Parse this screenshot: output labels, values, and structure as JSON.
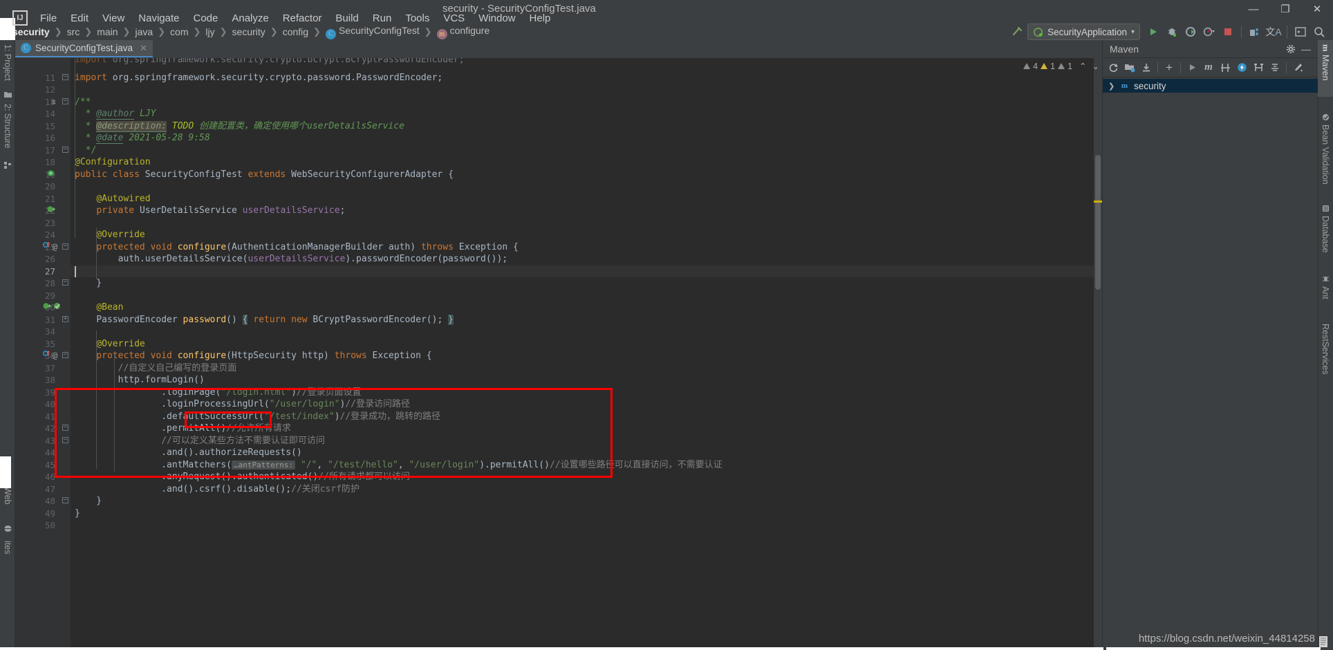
{
  "window": {
    "title": "security - SecurityConfigTest.java",
    "minimize": "—",
    "maximize": "❐",
    "close": "✕",
    "logo": "IJ"
  },
  "menu": {
    "items": [
      "File",
      "Edit",
      "View",
      "Navigate",
      "Code",
      "Analyze",
      "Refactor",
      "Build",
      "Run",
      "Tools",
      "VCS",
      "Window",
      "Help"
    ]
  },
  "breadcrumb": {
    "items": [
      {
        "label": "security",
        "icon": ""
      },
      {
        "label": "src",
        "icon": ""
      },
      {
        "label": "main",
        "icon": ""
      },
      {
        "label": "java",
        "icon": ""
      },
      {
        "label": "com",
        "icon": ""
      },
      {
        "label": "ljy",
        "icon": ""
      },
      {
        "label": "security",
        "icon": ""
      },
      {
        "label": "config",
        "icon": ""
      },
      {
        "label": "SecurityConfigTest",
        "icon": "C"
      },
      {
        "label": "configure",
        "icon": "m"
      }
    ],
    "separator": "❯"
  },
  "toolbar": {
    "build_icon": "build-hammer-icon",
    "run_config": "SecurityApplication",
    "run_config_caret": "▾",
    "run": "▶",
    "debug": "debug-bug-icon",
    "run_coverage": "coverage-icon",
    "profiler": "profiler-icon",
    "profiler_caret": "▾",
    "stop": "■",
    "project_structure": "project-structure-icon",
    "translate": "translate-icon",
    "terminal": "terminal-icon",
    "search": "⌕"
  },
  "left_strip": {
    "items": [
      {
        "label": "1: Project",
        "icon": "folder-icon"
      },
      {
        "label": "2: Structure",
        "icon": "structure-icon"
      },
      {
        "label": "Web",
        "icon": "globe-icon"
      },
      {
        "label": "ites",
        "icon": ""
      }
    ]
  },
  "right_strip": {
    "items": [
      {
        "label": "Maven",
        "icon": "m",
        "active": true
      },
      {
        "label": "Bean Validation",
        "icon": "bean-icon",
        "active": false
      },
      {
        "label": "Database",
        "icon": "database-icon",
        "active": false
      },
      {
        "label": "Ant",
        "icon": "ant-icon",
        "active": false
      },
      {
        "label": "RestServices",
        "icon": "",
        "active": false
      }
    ]
  },
  "editor_tab": {
    "label": "SecurityConfigTest.java",
    "icon": "C",
    "close": "✕"
  },
  "inspections": {
    "items": [
      {
        "icon": "grey-triangle-icon",
        "count": "4",
        "severity": "grey"
      },
      {
        "icon": "yellow-triangle-icon",
        "count": "1",
        "severity": "yellow"
      },
      {
        "icon": "grey-triangle-icon",
        "count": "1",
        "severity": "grey"
      }
    ],
    "prev": "⌃",
    "next": "⌄"
  },
  "maven": {
    "title": "Maven",
    "settings_icon": "gear-icon",
    "hide_icon": "—",
    "toolbar": [
      {
        "name": "reload-icon",
        "glyph": "⟳"
      },
      {
        "name": "add-maven-project-icon",
        "glyph": "Ὄ1"
      },
      {
        "name": "download-sources-icon",
        "glyph": "⤓"
      },
      {
        "name": "add-icon",
        "glyph": "＋"
      },
      {
        "name": "run-icon",
        "glyph": "▶"
      },
      {
        "name": "execute-maven-goal-icon",
        "glyph": "m"
      },
      {
        "name": "toggle-skip-tests-icon",
        "glyph": "⫴"
      },
      {
        "name": "toggle-offline-icon",
        "glyph": "⚡"
      },
      {
        "name": "show-dependencies-icon",
        "glyph": "⬌"
      },
      {
        "name": "collapse-all-icon",
        "glyph": "⫫"
      },
      {
        "name": "maven-settings-icon",
        "glyph": "⚒"
      }
    ],
    "tree": [
      {
        "label": "security",
        "chevron": "❯",
        "icon": "m",
        "selected": true
      }
    ]
  },
  "watermark": "https://blog.csdn.net/weixin_44814258",
  "code": {
    "lines": [
      {
        "n": "",
        "top_cut": true,
        "html": "<span class=\"kw\">import</span> org.springframework.security.crypto.bcrypt.BCryptPasswordEncoder;"
      },
      {
        "n": "11",
        "html": "<span class=\"kw\">import</span> org.springframework.security.crypto.password.PasswordEncoder;"
      },
      {
        "n": "12",
        "html": ""
      },
      {
        "n": "13",
        "html": "<span class=\"doc\">/**</span>"
      },
      {
        "n": "14",
        "html": "  <span class=\"doc\">*</span> <span class=\"docTag\">@author</span> <span class=\"doct\">LJY</span>"
      },
      {
        "n": "15",
        "html": "  <span class=\"doc\">*</span> <span class=\"dtagHl\">@description:</span> <span class=\"todo\">TODO</span> <span class=\"doct\">创建配置类，确定使用哪个userDetailsService</span>"
      },
      {
        "n": "16",
        "html": "  <span class=\"doc\">*</span> <span class=\"docTag\">@date</span> <span class=\"doct\">2021-05-28 9:58</span>"
      },
      {
        "n": "17",
        "html": "  <span class=\"doc\">*/</span>"
      },
      {
        "n": "18",
        "html": "<span class=\"anno\">@Configuration</span>"
      },
      {
        "n": "19",
        "html": "<span class=\"kw\">public class</span> <span class=\"cls\">SecurityConfigTest</span> <span class=\"kw\">extends</span> <span class=\"cls\">WebSecurityConfigurerAdapter</span> {"
      },
      {
        "n": "20",
        "html": ""
      },
      {
        "n": "21",
        "html": "    <span class=\"anno\">@Autowired</span>"
      },
      {
        "n": "22",
        "html": "    <span class=\"kw\">private</span> <span class=\"cls\">UserDetailsService</span> <span class=\"fld\">userDetailsService</span>;"
      },
      {
        "n": "23",
        "html": ""
      },
      {
        "n": "24",
        "html": "    <span class=\"anno\">@Override</span>"
      },
      {
        "n": "25",
        "html": "    <span class=\"kw\">protected void</span> <span class=\"mth\">configure</span>(<span class=\"cls\">AuthenticationManagerBuilder</span> auth) <span class=\"kw\">throws</span> <span class=\"cls\">Exception</span> {"
      },
      {
        "n": "26",
        "html": "        auth.userDetailsService(<span class=\"fld\">userDetailsService</span>).passwordEncoder(password());"
      },
      {
        "n": "27",
        "html": "",
        "current": true
      },
      {
        "n": "28",
        "html": "    }"
      },
      {
        "n": "29",
        "html": ""
      },
      {
        "n": "30",
        "html": "    <span class=\"anno\">@Bean</span>"
      },
      {
        "n": "31",
        "html": "    <span class=\"cls\">PasswordEncoder</span> <span class=\"mth\">password</span>() <span class=\"braceHl\">{</span> <span class=\"kw\">return new</span> <span class=\"cls\">BCryptPasswordEncoder</span>(); <span class=\"braceHl\">}</span>"
      },
      {
        "n": "34",
        "html": ""
      },
      {
        "n": "35",
        "html": "    <span class=\"anno\">@Override</span>"
      },
      {
        "n": "36",
        "html": "    <span class=\"kw\">protected void</span> <span class=\"mth\">configure</span>(<span class=\"cls\">HttpSecurity</span> http) <span class=\"kw\">throws</span> <span class=\"cls\">Exception</span> {"
      },
      {
        "n": "37",
        "html": "        <span class=\"cmt\">//自定义自己编写的登录页面</span>"
      },
      {
        "n": "38",
        "html": "        http.formLogin()"
      },
      {
        "n": "39",
        "html": "                .loginPage(<span class=\"str\">\"/login.html\"</span>)<span class=\"cmt\">//登录页面设置</span>"
      },
      {
        "n": "40",
        "html": "                .loginProcessingUrl(<span class=\"str\">\"/user/login\"</span>)<span class=\"cmt\">//登录访问路径</span>"
      },
      {
        "n": "41",
        "html": "                .defaultSuccessUrl(<span class=\"str\">\"/test/index\"</span>)<span class=\"cmt\">//登录成功，跳转的路径</span>"
      },
      {
        "n": "42",
        "html": "                .permitAll()<span class=\"cmt\">//允许所有请求</span>"
      },
      {
        "n": "43",
        "html": "                <span class=\"cmt\">//可以定义某些方法不需要认证即可访问</span>"
      },
      {
        "n": "44",
        "html": "                .and().authorizeRequests()"
      },
      {
        "n": "45",
        "html": "                .antMatchers(<span class=\"hint\">…antPatterns:</span> <span class=\"str\">\"/\"</span>, <span class=\"str\">\"/test/hello\"</span>, <span class=\"str\">\"/user/login\"</span>).permitAll()<span class=\"cmt\">//设置哪些路径可以直接访问，不需要认证</span>"
      },
      {
        "n": "46",
        "html": "                .anyRequest().authenticated()<span class=\"cmt\">//所有请求都可以访问</span>"
      },
      {
        "n": "47",
        "html": "                .and().csrf().disable();<span class=\"cmt\">//关闭csrf防护</span>"
      },
      {
        "n": "48",
        "html": "    }"
      },
      {
        "n": "49",
        "html": "}"
      },
      {
        "n": "50",
        "html": ""
      }
    ]
  }
}
